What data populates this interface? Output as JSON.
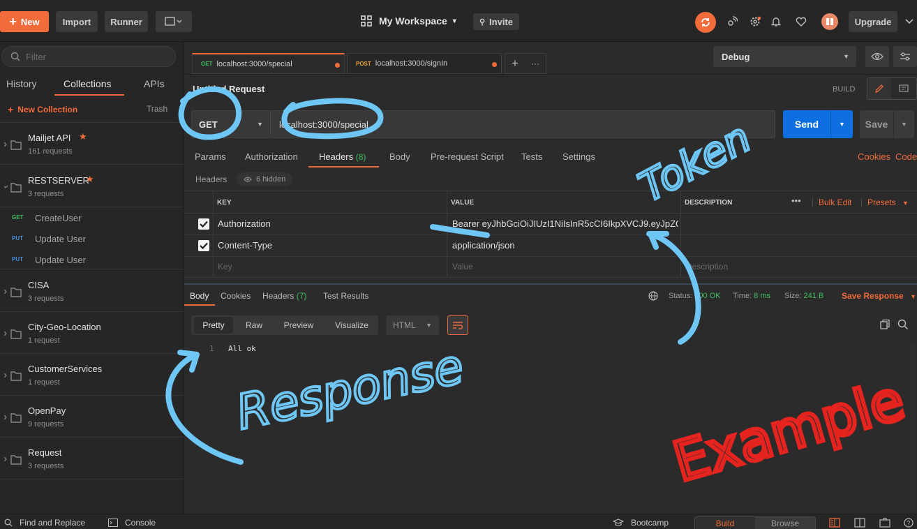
{
  "topbar": {
    "new_label": "New",
    "import_label": "Import",
    "runner_label": "Runner",
    "workspace_label": "My Workspace",
    "invite_label": "Invite",
    "upgrade_label": "Upgrade"
  },
  "sidebar": {
    "filter_placeholder": "Filter",
    "tabs": [
      "History",
      "Collections",
      "APIs"
    ],
    "new_collection_label": "New Collection",
    "trash_label": "Trash",
    "collections": [
      {
        "name": "Mailjet API",
        "count": "161 requests"
      },
      {
        "name": "RESTSERVER",
        "count": "3 requests"
      },
      {
        "name": "CISA",
        "count": "3 requests"
      },
      {
        "name": "City-Geo-Location",
        "count": "1 request"
      },
      {
        "name": "CustomerServices",
        "count": "1 request"
      },
      {
        "name": "OpenPay",
        "count": "9 requests"
      },
      {
        "name": "Request",
        "count": "3 requests"
      }
    ],
    "requests": [
      {
        "method": "GET",
        "name": "CreateUser"
      },
      {
        "method": "PUT",
        "name": "Update User"
      },
      {
        "method": "PUT",
        "name": "Update User"
      }
    ]
  },
  "tabs": [
    {
      "method": "GET",
      "url": "localhost:3000/special"
    },
    {
      "method": "POST",
      "url": "localhost:3000/signIn"
    }
  ],
  "environment": "Debug",
  "request": {
    "title": "Untitled Request",
    "build_label": "BUILD",
    "method": "GET",
    "url": "localhost:3000/special",
    "send_label": "Send",
    "save_label": "Save"
  },
  "request_tabs": {
    "params": "Params",
    "authorization": "Authorization",
    "headers": "Headers",
    "headers_count": "(8)",
    "body": "Body",
    "prerequest": "Pre-request Script",
    "tests": "Tests",
    "settings": "Settings",
    "cookies": "Cookies",
    "code": "Code"
  },
  "headers_section": {
    "label": "Headers",
    "hidden": "6 hidden",
    "col_key": "KEY",
    "col_value": "VALUE",
    "col_description": "DESCRIPTION",
    "bulk_edit": "Bulk Edit",
    "presets": "Presets",
    "rows": [
      {
        "key": "Authorization",
        "value": "Bearer eyJhbGciOiJIUzI1NiIsInR5cCI6IkpXVCJ9.eyJpZCI6Ij'…"
      },
      {
        "key": "Content-Type",
        "value": "application/json"
      }
    ],
    "key_placeholder": "Key",
    "value_placeholder": "Value",
    "description_placeholder": "Description"
  },
  "response": {
    "tabs": {
      "body": "Body",
      "cookies": "Cookies",
      "headers": "Headers",
      "headers_count": "(7)",
      "test_results": "Test Results"
    },
    "status_label": "Status:",
    "status_value": "200 OK",
    "time_label": "Time:",
    "time_value": "8 ms",
    "size_label": "Size:",
    "size_value": "241 B",
    "save_response": "Save Response",
    "view_tabs": [
      "Pretty",
      "Raw",
      "Preview",
      "Visualize"
    ],
    "format": "HTML",
    "line_number": "1",
    "body_text": "All ok"
  },
  "annotations": {
    "token": "Token",
    "response": "Response",
    "example": "Example"
  },
  "bottombar": {
    "find_replace": "Find and Replace",
    "console": "Console",
    "bootcamp": "Bootcamp",
    "build": "Build",
    "browse": "Browse"
  },
  "colors": {
    "accent_orange": "#f26b3a",
    "send_blue": "#0e6fe0",
    "annotation_blue": "#6ec6f5",
    "annotation_red": "#e5231f",
    "status_green": "#3fbf5f"
  }
}
